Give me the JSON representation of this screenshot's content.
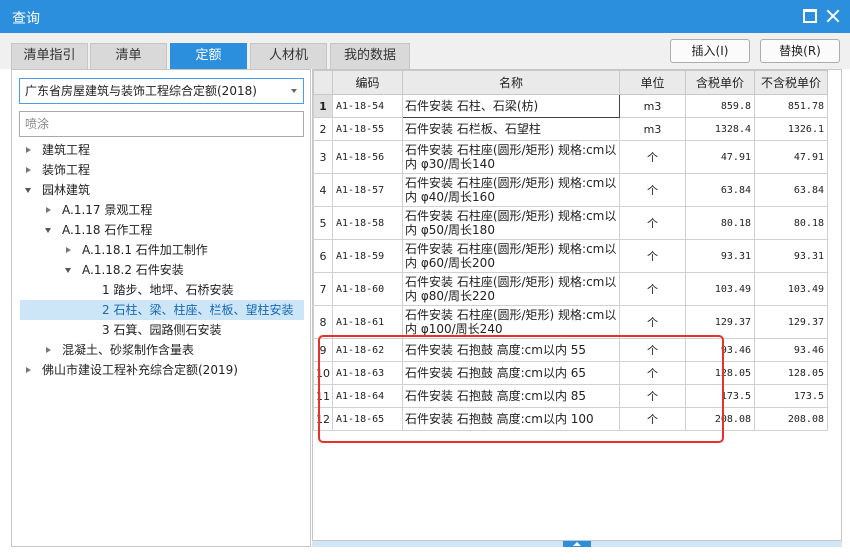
{
  "window": {
    "title": "查询"
  },
  "tabs": [
    {
      "label": "清单指引",
      "active": false
    },
    {
      "label": "清单",
      "active": false
    },
    {
      "label": "定额",
      "active": true
    },
    {
      "label": "人材机",
      "active": false
    },
    {
      "label": "我的数据",
      "active": false
    }
  ],
  "toolbar": {
    "insert_label": "插入(I)",
    "replace_label": "替换(R)"
  },
  "left": {
    "quota_select": "广东省房屋建筑与装饰工程综合定额(2018)",
    "search_value": "喷涂",
    "tree": [
      {
        "label": "建筑工程",
        "level": 0,
        "state": "collapsed",
        "selected": false
      },
      {
        "label": "装饰工程",
        "level": 0,
        "state": "collapsed",
        "selected": false
      },
      {
        "label": "园林建筑",
        "level": 0,
        "state": "expanded",
        "selected": false
      },
      {
        "label": "A.1.17 景观工程",
        "level": 1,
        "state": "collapsed",
        "selected": false
      },
      {
        "label": "A.1.18 石作工程",
        "level": 1,
        "state": "expanded",
        "selected": false
      },
      {
        "label": "A.1.18.1 石件加工制作",
        "level": 2,
        "state": "collapsed",
        "selected": false
      },
      {
        "label": "A.1.18.2 石件安装",
        "level": 2,
        "state": "expanded",
        "selected": false
      },
      {
        "label": "1 踏步、地坪、石桥安装",
        "level": 3,
        "state": "leaf",
        "selected": false
      },
      {
        "label": "2 石柱、梁、柱座、栏板、望柱安装",
        "level": 3,
        "state": "leaf",
        "selected": true
      },
      {
        "label": "3 石箕、园路侧石安装",
        "level": 3,
        "state": "leaf",
        "selected": false
      },
      {
        "label": "混凝土、砂浆制作含量表",
        "level": 1,
        "state": "collapsed",
        "selected": false
      },
      {
        "label": "佛山市建设工程补充综合定额(2019)",
        "level": 0,
        "state": "collapsed",
        "selected": false
      }
    ]
  },
  "table": {
    "headers": [
      "",
      "编码",
      "名称",
      "单位",
      "含税单价",
      "不含税单价"
    ],
    "rows": [
      {
        "no": "1",
        "code": "A1-18-54",
        "name": "石件安装 石柱、石梁(枋)",
        "unit": "m3",
        "price_tax": "859.8",
        "price_notax": "851.78"
      },
      {
        "no": "2",
        "code": "A1-18-55",
        "name": "石件安装 石栏板、石望柱",
        "unit": "m3",
        "price_tax": "1328.4",
        "price_notax": "1326.1"
      },
      {
        "no": "3",
        "code": "A1-18-56",
        "name": "石件安装 石柱座(圆形/矩形) 规格:cm以内 φ30/周长140",
        "unit": "个",
        "price_tax": "47.91",
        "price_notax": "47.91"
      },
      {
        "no": "4",
        "code": "A1-18-57",
        "name": "石件安装 石柱座(圆形/矩形) 规格:cm以内 φ40/周长160",
        "unit": "个",
        "price_tax": "63.84",
        "price_notax": "63.84"
      },
      {
        "no": "5",
        "code": "A1-18-58",
        "name": "石件安装 石柱座(圆形/矩形) 规格:cm以内 φ50/周长180",
        "unit": "个",
        "price_tax": "80.18",
        "price_notax": "80.18"
      },
      {
        "no": "6",
        "code": "A1-18-59",
        "name": "石件安装 石柱座(圆形/矩形) 规格:cm以内 φ60/周长200",
        "unit": "个",
        "price_tax": "93.31",
        "price_notax": "93.31"
      },
      {
        "no": "7",
        "code": "A1-18-60",
        "name": "石件安装 石柱座(圆形/矩形) 规格:cm以内 φ80/周长220",
        "unit": "个",
        "price_tax": "103.49",
        "price_notax": "103.49"
      },
      {
        "no": "8",
        "code": "A1-18-61",
        "name": "石件安装 石柱座(圆形/矩形) 规格:cm以内 φ100/周长240",
        "unit": "个",
        "price_tax": "129.37",
        "price_notax": "129.37"
      },
      {
        "no": "9",
        "code": "A1-18-62",
        "name": "石件安装 石抱鼓 高度:cm以内 55",
        "unit": "个",
        "price_tax": "93.46",
        "price_notax": "93.46"
      },
      {
        "no": "10",
        "code": "A1-18-63",
        "name": "石件安装 石抱鼓 高度:cm以内 65",
        "unit": "个",
        "price_tax": "128.05",
        "price_notax": "128.05"
      },
      {
        "no": "11",
        "code": "A1-18-64",
        "name": "石件安装 石抱鼓 高度:cm以内 85",
        "unit": "个",
        "price_tax": "173.5",
        "price_notax": "173.5"
      },
      {
        "no": "12",
        "code": "A1-18-65",
        "name": "石件安装 石抱鼓 高度:cm以内 100",
        "unit": "个",
        "price_tax": "208.08",
        "price_notax": "208.08"
      }
    ]
  },
  "colors": {
    "accent": "#2b8fde",
    "highlight_box": "#e8312b",
    "selected_bg": "#cde6f7"
  },
  "icons": {
    "maximize": "maximize-icon",
    "close": "close-icon",
    "dropdown": "chevron-down-icon",
    "tree_collapsed": "triangle-right-icon",
    "tree_expanded": "triangle-down-icon"
  }
}
